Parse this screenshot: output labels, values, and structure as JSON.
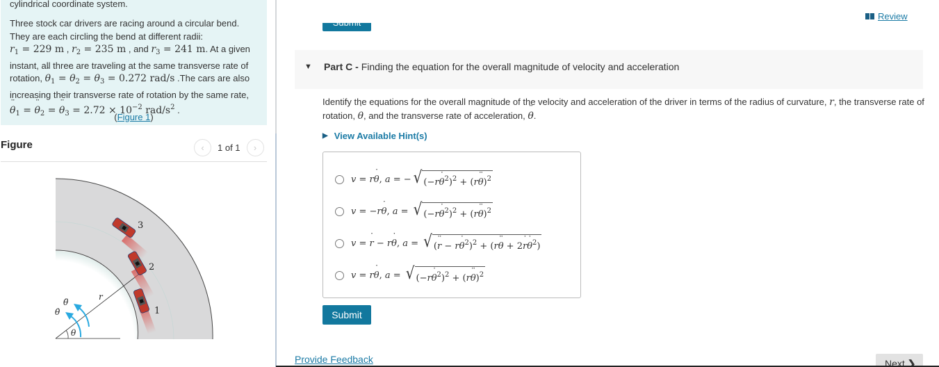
{
  "problem": {
    "intro_tail": "cylindrical coordinate system.",
    "sentence1": "Three stock car drivers are racing around a circular bend. They are each circling the bend at different radii:",
    "r1": "229",
    "r2": "235",
    "r3": "241",
    "unit_m": "m",
    "and_text": "and",
    "given_text": ". At a given instant, all three are traveling at the same transverse rate of rotation,",
    "theta_dot_value": "0.272",
    "theta_dot_unit": "rad/s",
    "sentence3": ".The cars are also increasing their transverse rate of rotation by the same rate,",
    "theta_ddot_value": "2.72",
    "theta_ddot_exp": "−2",
    "theta_ddot_unit": "rad/s",
    "figure_link_open": "(",
    "figure_link": "Figure 1",
    "figure_link_close": ")"
  },
  "figure": {
    "heading": "Figure",
    "pager_text": "1 of 1",
    "prev_icon": "chevron-left-icon",
    "next_icon": "chevron-right-icon",
    "labels": {
      "car1": "1",
      "car2": "2",
      "car3": "3",
      "radius": "r",
      "angle": "θ",
      "theta_dot": "θ̇",
      "theta_ddot": "θ̈"
    },
    "colors": {
      "track": "#d9d9da",
      "car": "#c0392b",
      "arrow": "#29a9e0"
    }
  },
  "header": {
    "review_label": "Review",
    "review_icon": "book-icon",
    "top_submit_label": "Submit"
  },
  "part": {
    "label": "Part C -",
    "title": "Finding the equation for the overall magnitude of velocity and acceleration",
    "expanded": true
  },
  "instructions": {
    "text1": "Identify the equations for the overall magnitude of the velocity and acceleration of the driver in terms of the radius of curvature,",
    "var_r": "r",
    "text2": ", the transverse rate of rotation,",
    "text3": ", and the transverse rate of acceleration,",
    "text4": "."
  },
  "hints": {
    "label": "View Available Hint(s)"
  },
  "choices": [
    {
      "id": "a",
      "selected": false,
      "text": "v = rθ̇, a = −√((−rθ̇²)² + (rθ̈)²)"
    },
    {
      "id": "b",
      "selected": false,
      "text": "v = −rθ̇, a = √((−rθ̇²)² + (rθ̈)²)"
    },
    {
      "id": "c",
      "selected": false,
      "text": "v = ṙ − rθ̇, a = √((r̈ − rθ̇²)² + (rθ̈ + 2ṙθ̇²))"
    },
    {
      "id": "d",
      "selected": false,
      "text": "v = rθ̇, a = √((−rθ̇²)² + (rθ̈)²)"
    }
  ],
  "actions": {
    "submit_label": "Submit",
    "feedback_label": "Provide Feedback",
    "next_label": "Next",
    "next_icon": "chevron-right-icon"
  },
  "colors": {
    "accent": "#12789e",
    "link": "#1a7aa5",
    "problem_bg": "#e5f4f5",
    "part_bg": "#f7f7f7"
  }
}
